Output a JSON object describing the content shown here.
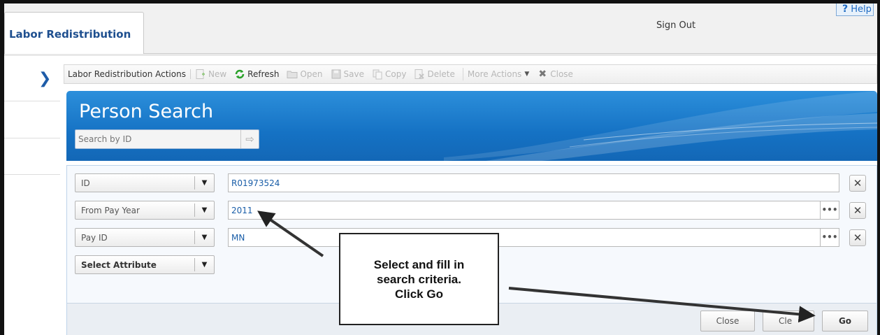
{
  "header": {
    "tab_label": "Labor Redistribution",
    "sign_out": "Sign Out",
    "help_icon": "question-mark-icon",
    "help_mark": "?",
    "help_label": "Help"
  },
  "toolbar": {
    "title": "Labor Redistribution Actions",
    "new": "New",
    "refresh": "Refresh",
    "open": "Open",
    "save": "Save",
    "copy": "Copy",
    "delete": "Delete",
    "more_actions": "More Actions",
    "close": "Close"
  },
  "banner": {
    "title": "Person Search",
    "search_placeholder": "Search by ID"
  },
  "criteria": [
    {
      "attribute": "ID",
      "value": "R01973524"
    },
    {
      "attribute": "From Pay Year",
      "value": "2011"
    },
    {
      "attribute": "Pay ID",
      "value": "MN"
    },
    {
      "attribute": "Select Attribute"
    }
  ],
  "footer": {
    "close": "Close",
    "clear": "Cle",
    "go": "Go"
  },
  "annotation": {
    "text": "Select and fill in\nsearch criteria.\nClick Go"
  },
  "colors": {
    "brand_blue": "#1572c4",
    "tab_text": "#1e4f8f",
    "value_text": "#1a5ea8"
  }
}
